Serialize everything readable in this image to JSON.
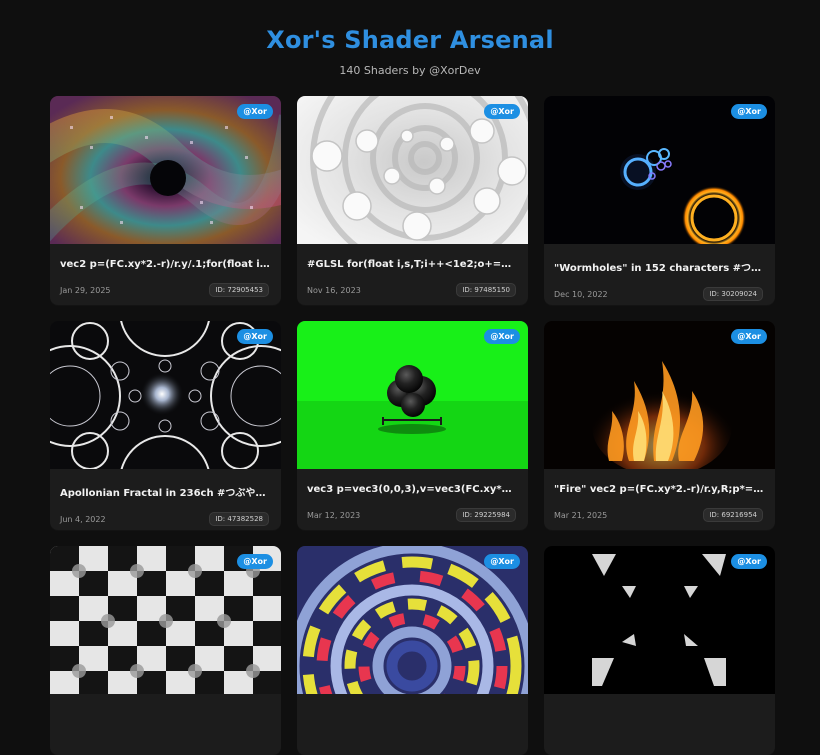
{
  "header": {
    "title": "Xor's Shader Arsenal",
    "subtitle": "140 Shaders by @XorDev"
  },
  "colors": {
    "accent": "#2f8fe0",
    "badge": "#1c8fe3",
    "background": "#0f0f0f",
    "card": "#1c1c1c"
  },
  "cards": [
    {
      "badge": "@Xor",
      "title": "vec2 p=(FC.xy*2.-r)/r.y/.1;for(float i;i++<...",
      "date": "Jan 29, 2025",
      "id": "ID: 72905453",
      "thumb": "rainbow-spiral"
    },
    {
      "badge": "@Xor",
      "title": "#GLSL for(float i,s,T;i++<1e2;o+=1e-4/(.0...",
      "date": "Nov 16, 2023",
      "id": "ID: 97485150",
      "thumb": "white-blob-vortex"
    },
    {
      "badge": "@Xor",
      "title": "\"Wormholes\" in 152 characters #つぶやき...",
      "date": "Dec 10, 2022",
      "id": "ID: 30209024",
      "thumb": "glowing-rings"
    },
    {
      "badge": "@Xor",
      "title": "Apollonian Fractal in 236ch #つぶやきGLSL...",
      "date": "Jun 4, 2022",
      "id": "ID: 47382528",
      "thumb": "apollonian-fractal"
    },
    {
      "badge": "@Xor",
      "title": "vec3 p=vec3(0,0,3),v=vec3(FC.xy*2.-r,r.y);f...",
      "date": "Mar 12, 2023",
      "id": "ID: 29225984",
      "thumb": "green-blob"
    },
    {
      "badge": "@Xor",
      "title": "\"Fire\" vec2 p=(FC.xy*2.-r)/r.y,R;p*=1.-vec...",
      "date": "Mar 21, 2025",
      "id": "ID: 69216954",
      "thumb": "fire"
    },
    {
      "badge": "@Xor",
      "title": "",
      "date": "",
      "id": "",
      "thumb": "checker-blobs"
    },
    {
      "badge": "@Xor",
      "title": "",
      "date": "",
      "id": "",
      "thumb": "colorful-rings"
    },
    {
      "badge": "@Xor",
      "title": "",
      "date": "",
      "id": "",
      "thumb": "black-shapes"
    }
  ]
}
